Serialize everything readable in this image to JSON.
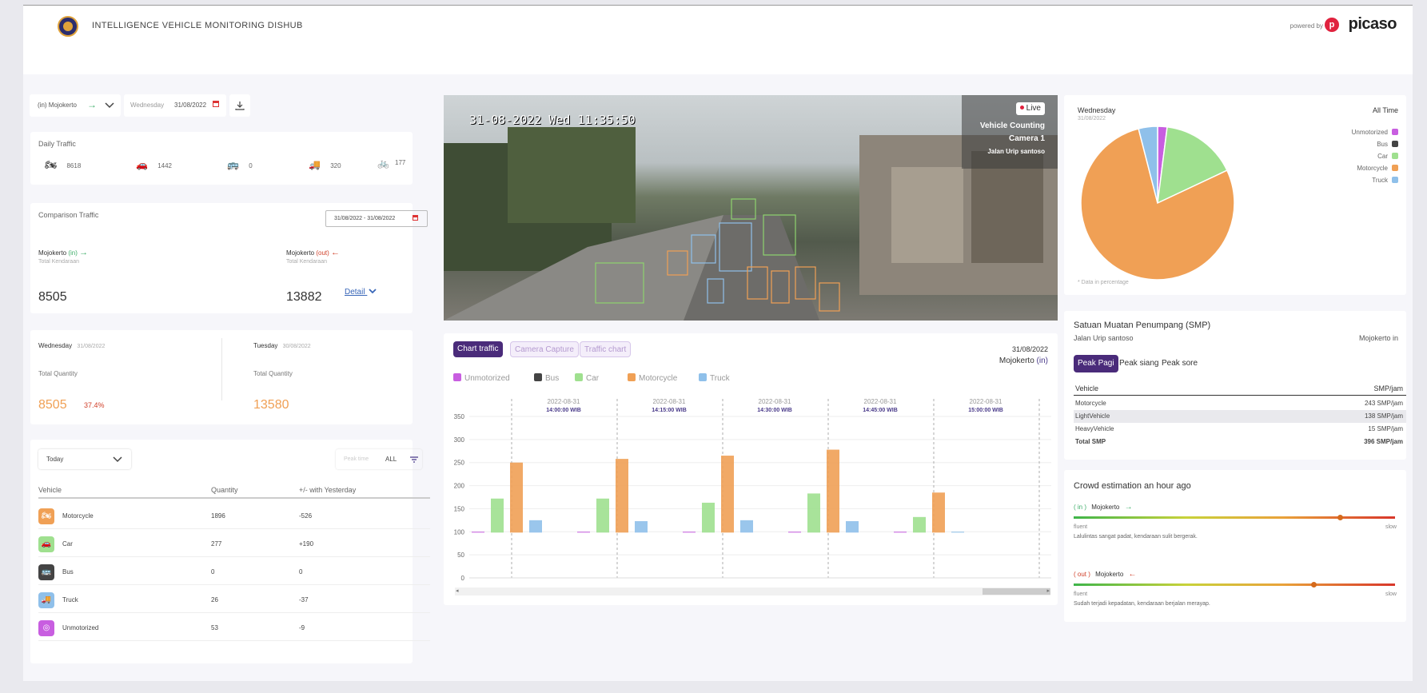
{
  "header": {
    "title": "INTELLIGENCE VEHICLE MONITORING DISHUB",
    "powered_by": "powered by",
    "brand": "picaso"
  },
  "filters": {
    "location": "(in) Mojokerto",
    "day": "Wednesday",
    "date": "31/08/2022"
  },
  "daily_traffic": {
    "title": "Daily Traffic",
    "items": [
      {
        "icon": "motorcycle-icon",
        "value": "8618"
      },
      {
        "icon": "car-icon",
        "value": "1442"
      },
      {
        "icon": "bus-icon",
        "value": "0"
      },
      {
        "icon": "truck-icon",
        "value": "320"
      },
      {
        "icon": "unmotorized-icon",
        "value": "177"
      }
    ]
  },
  "comparison": {
    "title": "Comparison Traffic",
    "date_range": "31/08/2022 - 31/08/2022",
    "in_label": "Mojokerto",
    "in_dir": "(in)",
    "out_label": "Mojokerto",
    "out_dir": "(out)",
    "sublabel": "Total Kendaraan",
    "in_value": "8505",
    "out_value": "13882",
    "detail": "Detail"
  },
  "day_compare": {
    "left_day": "Wednesday",
    "left_date": "31/08/2022",
    "right_day": "Tuesday",
    "right_date": "30/08/2022",
    "qty_label": "Total Quantity",
    "left_value": "8505",
    "left_pct": "37.4%",
    "right_value": "13580"
  },
  "vehicle_table": {
    "period": "Today",
    "peak_label": "Peak time",
    "peak_value": "ALL",
    "col_vehicle": "Vehicle",
    "col_qty": "Quantity",
    "col_delta": "+/- with Yesterday",
    "rows": [
      {
        "name": "Motorcycle",
        "qty": "1896",
        "delta": "-526",
        "color": "#f0a055"
      },
      {
        "name": "Car",
        "qty": "277",
        "delta": "+190",
        "color": "#9fe08f"
      },
      {
        "name": "Bus",
        "qty": "0",
        "delta": "0",
        "color": "#444444"
      },
      {
        "name": "Truck",
        "qty": "26",
        "delta": "-37",
        "color": "#8fc0ea"
      },
      {
        "name": "Unmotorized",
        "qty": "53",
        "delta": "-9",
        "color": "#c85ee0"
      }
    ]
  },
  "camera": {
    "timestamp": "31-08-2022 Wed 11:35:50",
    "live": "Live",
    "title": "Vehicle Counting",
    "camera_name": "Camera 1",
    "street": "Jalan Urip santoso"
  },
  "traffic_panel": {
    "tabs": [
      "Chart traffic",
      "Camera Capture",
      "Traffic chart"
    ],
    "date": "31/08/2022",
    "location": "Mojokerto",
    "direction": "(in)",
    "legend": [
      {
        "name": "Unmotorized",
        "color": "#c85ee0"
      },
      {
        "name": "Bus",
        "color": "#444444"
      },
      {
        "name": "Car",
        "color": "#9fe08f"
      },
      {
        "name": "Motorcycle",
        "color": "#f0a055"
      },
      {
        "name": "Truck",
        "color": "#8fc0ea"
      }
    ]
  },
  "chart_data": {
    "type": "bar",
    "categories": [
      "14:00:00 WIB",
      "14:15:00 WIB",
      "14:30:00 WIB",
      "14:45:00 WIB",
      "15:00:00 WIB",
      ""
    ],
    "category_dates": [
      "2022-08-31",
      "2022-08-31",
      "2022-08-31",
      "2022-08-31",
      "2022-08-31",
      "2022-08-31"
    ],
    "ylim": [
      0,
      350
    ],
    "yticks": [
      0,
      50,
      100,
      150,
      200,
      250,
      300,
      350
    ],
    "series": [
      {
        "name": "Unmotorized",
        "values": [
          0,
          0,
          0,
          1,
          1,
          null
        ]
      },
      {
        "name": "Bus",
        "values": [
          0,
          0,
          0,
          0,
          0,
          null
        ]
      },
      {
        "name": "Car",
        "values": [
          172,
          172,
          163,
          183,
          132,
          null
        ]
      },
      {
        "name": "Motorcycle",
        "values": [
          250,
          258,
          265,
          278,
          185,
          null
        ]
      },
      {
        "name": "Truck",
        "values": [
          125,
          123,
          125,
          123,
          100,
          null
        ]
      }
    ]
  },
  "pie": {
    "day": "Wednesday",
    "date": "31/08/2022",
    "range": "All Time",
    "note": "* Data in percentage",
    "legend": [
      {
        "name": "Unmotorized",
        "color": "#c85ee0"
      },
      {
        "name": "Bus",
        "color": "#444444"
      },
      {
        "name": "Car",
        "color": "#9fe08f"
      },
      {
        "name": "Motorcycle",
        "color": "#f0a055"
      },
      {
        "name": "Truck",
        "color": "#8fc0ea"
      }
    ],
    "slices": [
      {
        "name": "Unmotorized",
        "value": 2,
        "color": "#c85ee0"
      },
      {
        "name": "Car",
        "value": 16,
        "color": "#9fe08f"
      },
      {
        "name": "Motorcycle",
        "value": 78,
        "color": "#f0a055"
      },
      {
        "name": "Truck",
        "value": 4,
        "color": "#8fc0ea"
      }
    ]
  },
  "smp": {
    "title": "Satuan Muatan Penumpang (SMP)",
    "street": "Jalan Urip santoso",
    "location": "Mojokerto in",
    "tabs": [
      "Peak Pagi",
      "Peak siang",
      "Peak sore"
    ],
    "col_vehicle": "Vehicle",
    "col_value": "SMP/jam",
    "rows": [
      {
        "name": "Motorcycle",
        "value": "243 SMP/jam"
      },
      {
        "name": "LightVehicle",
        "value": "138 SMP/jam"
      },
      {
        "name": "HeavyVehicle",
        "value": "15 SMP/jam"
      }
    ],
    "total_label": "Total SMP",
    "total_value": "396 SMP/jam"
  },
  "crowd": {
    "title": "Crowd estimation an hour ago",
    "in_dir": "( in )",
    "in_loc": "Mojokerto",
    "in_level": 0.82,
    "in_msg": "Lalulintas sangat padat, kendaraan sulit bergerak.",
    "out_dir": "( out )",
    "out_loc": "Mojokerto",
    "out_level": 0.74,
    "out_msg": "Sudah terjadi kepadatan, kendaraan berjalan merayap.",
    "fluent": "fluent",
    "slow": "slow"
  }
}
